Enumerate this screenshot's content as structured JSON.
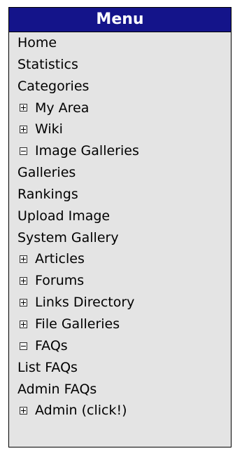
{
  "menu": {
    "title": "Menu",
    "items": [
      {
        "label": "Home"
      },
      {
        "label": "Statistics"
      },
      {
        "label": "Categories"
      },
      {
        "label": "My Area",
        "toggle": "plus-box-icon"
      },
      {
        "label": "Wiki",
        "toggle": "plus-box-icon"
      },
      {
        "label": "Image Galleries",
        "toggle": "minus-box-icon"
      },
      {
        "label": "Galleries"
      },
      {
        "label": "Rankings"
      },
      {
        "label": "Upload Image"
      },
      {
        "label": "System Gallery"
      },
      {
        "label": "Articles",
        "toggle": "plus-box-icon"
      },
      {
        "label": "Forums",
        "toggle": "plus-box-icon"
      },
      {
        "label": "Links Directory",
        "toggle": "plus-box-icon"
      },
      {
        "label": "File Galleries",
        "toggle": "plus-box-icon"
      },
      {
        "label": "FAQs",
        "toggle": "minus-box-icon"
      },
      {
        "label": "List FAQs"
      },
      {
        "label": "Admin FAQs"
      },
      {
        "label": "Admin (click!)",
        "toggle": "plus-box-icon"
      }
    ]
  },
  "colors": {
    "header_bg": "#14148a",
    "panel_bg": "#e4e4e4"
  }
}
